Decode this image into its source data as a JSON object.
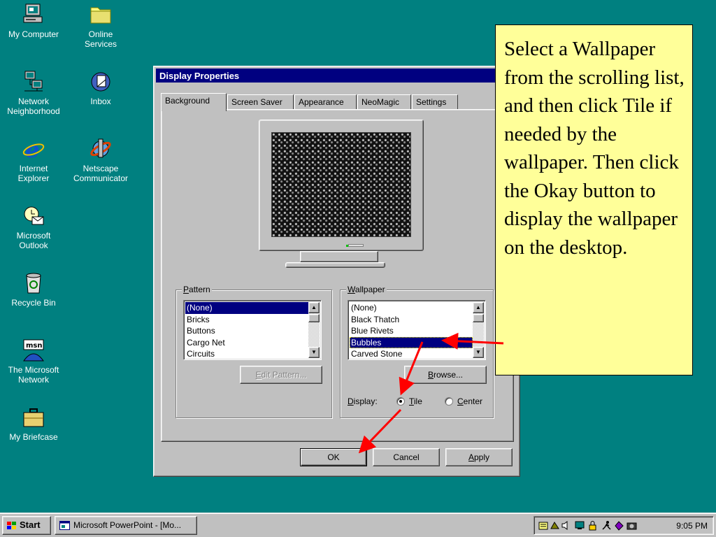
{
  "desktop": {
    "icons": [
      {
        "label": "My Computer",
        "icon": "computer-icon"
      },
      {
        "label": "Online\nServices",
        "icon": "folder-icon"
      },
      {
        "label": "Network\nNeighborhood",
        "icon": "network-icon"
      },
      {
        "label": "Inbox",
        "icon": "inbox-icon"
      },
      {
        "label": "Internet\nExplorer",
        "icon": "ie-icon"
      },
      {
        "label": "Netscape\nCommunicator",
        "icon": "netscape-icon"
      },
      {
        "label": "Microsoft\nOutlook",
        "icon": "outlook-icon"
      },
      {
        "label": "Recycle Bin",
        "icon": "recycle-bin-icon"
      },
      {
        "label": "The Microsoft\nNetwork",
        "icon": "msn-icon"
      },
      {
        "label": "My Briefcase",
        "icon": "briefcase-icon"
      }
    ],
    "background_color": "#008080"
  },
  "dialog": {
    "title": "Display Properties",
    "help_label": "?",
    "tabs": [
      {
        "label": "Background",
        "active": true
      },
      {
        "label": "Screen Saver"
      },
      {
        "label": "Appearance"
      },
      {
        "label": "NeoMagic"
      },
      {
        "label": "Settings"
      }
    ],
    "pattern": {
      "legend_key": "P",
      "legend_rest": "attern",
      "items": [
        "(None)",
        "Bricks",
        "Buttons",
        "Cargo Net",
        "Circuits"
      ],
      "selected": "(None)",
      "edit_button_key": "E",
      "edit_button_rest": "dit Pattern..."
    },
    "wallpaper": {
      "legend_key": "W",
      "legend_rest": "allpaper",
      "items": [
        "(None)",
        "Black Thatch",
        "Blue Rivets",
        "Bubbles",
        "Carved Stone"
      ],
      "selected": "Bubbles",
      "browse_button_key": "B",
      "browse_button_rest": "rowse...",
      "display_label_key": "D",
      "display_label_rest": "isplay:",
      "tile_key": "T",
      "tile_rest": "ile",
      "center_key": "C",
      "center_rest": "enter",
      "display_mode": "Tile"
    },
    "buttons": {
      "ok": "OK",
      "cancel": "Cancel",
      "apply_key": "A",
      "apply_rest": "pply"
    }
  },
  "note": {
    "text": "Select a Wallpaper from the scrolling list, and then click Tile if needed by the wallpaper. Then click the Okay button to display the wallpaper on the desktop.",
    "background_color": "#ffff99",
    "arrow_color": "#ff0000"
  },
  "taskbar": {
    "start_label": "Start",
    "task_label": "Microsoft PowerPoint - [Mo...",
    "tray_icons": [
      "scheduler-icon",
      "network-tray-icon",
      "volume-icon",
      "monitor-tray-icon",
      "lock-icon",
      "runner-icon",
      "chat-icon",
      "camera-icon"
    ],
    "clock": "9:05 PM"
  }
}
